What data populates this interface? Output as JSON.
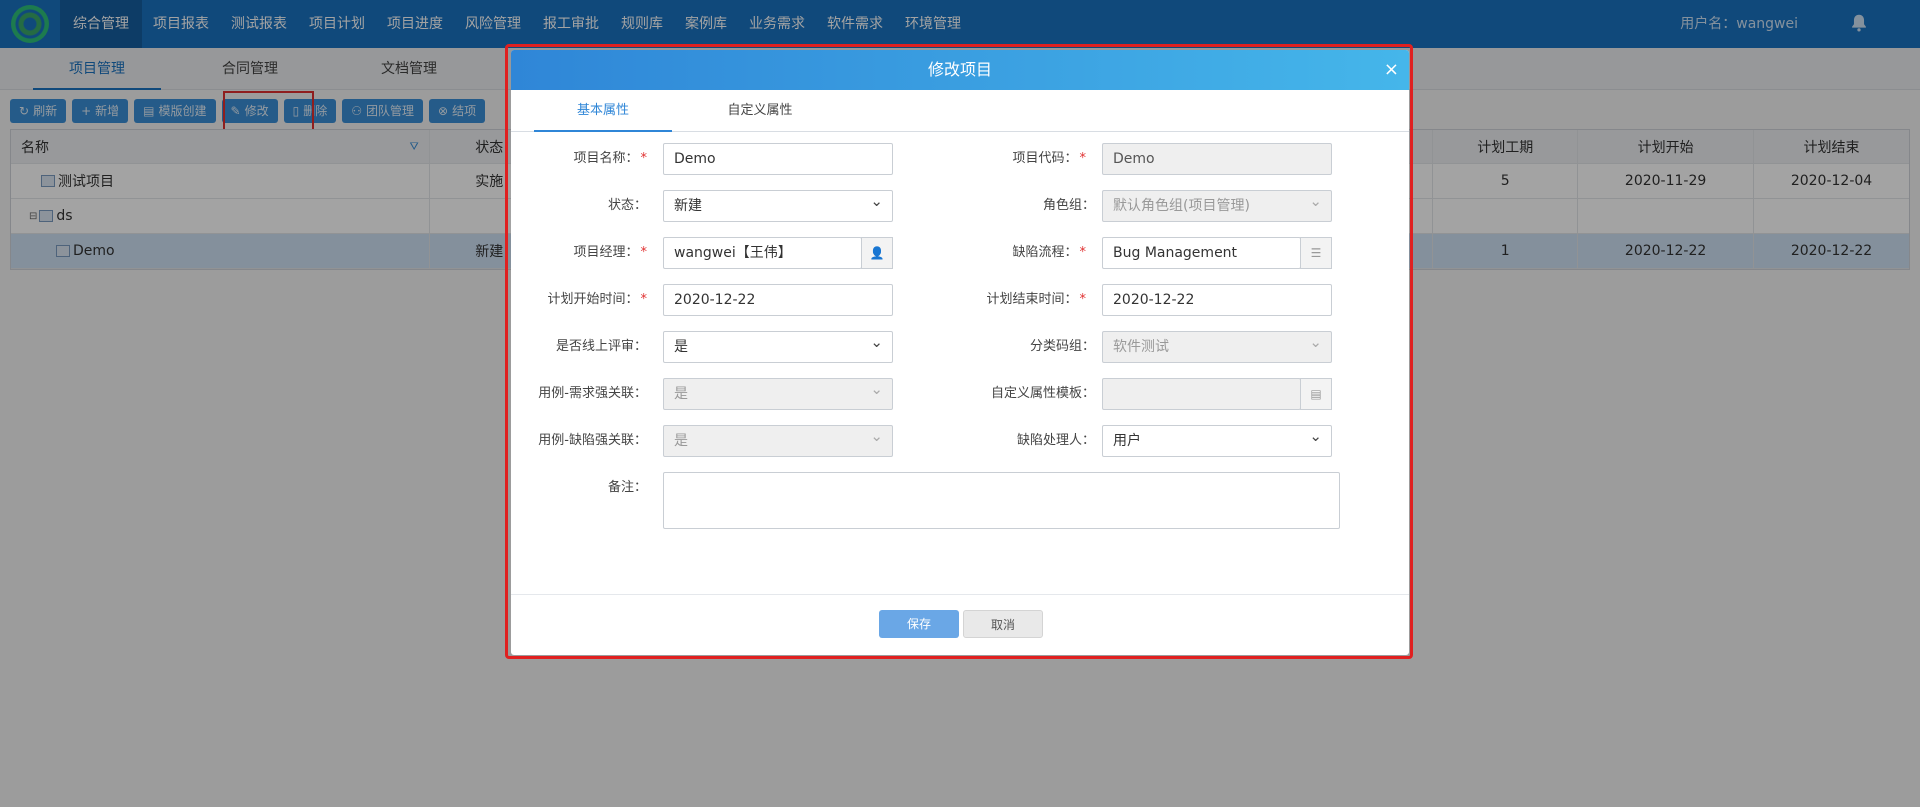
{
  "nav": {
    "items": [
      "综合管理",
      "项目报表",
      "测试报表",
      "项目计划",
      "项目进度",
      "风险管理",
      "报工审批",
      "规则库",
      "案例库",
      "业务需求",
      "软件需求",
      "环境管理"
    ],
    "active_index": 0,
    "user_label": "用户名：wangwei",
    "bell_icon": "bell-icon"
  },
  "subtabs": [
    "项目管理",
    "合同管理",
    "文档管理"
  ],
  "toolbar": [
    {
      "icon": "↻",
      "label": "刷新"
    },
    {
      "icon": "+",
      "label": "新增"
    },
    {
      "icon": "▤",
      "label": "模版创建"
    },
    {
      "icon": "✎",
      "label": "修改"
    },
    {
      "icon": "▯",
      "label": "删除"
    },
    {
      "icon": "⚇",
      "label": "团队管理"
    },
    {
      "icon": "⊗",
      "label": "结项"
    }
  ],
  "grid": {
    "headers": {
      "name": "名称",
      "status": "状态",
      "period": "计划工期",
      "start": "计划开始",
      "end": "计划结束"
    },
    "rows": [
      {
        "name": "测试项目",
        "status": "实施",
        "period": "5",
        "start": "2020-11-29",
        "end": "2020-12-04"
      },
      {
        "name": "ds",
        "status": "",
        "period": "",
        "start": "",
        "end": ""
      },
      {
        "name": "Demo",
        "status": "新建",
        "period": "1",
        "start": "2020-12-22",
        "end": "2020-12-22"
      }
    ]
  },
  "dialog": {
    "title": "修改项目",
    "close": "×",
    "tabs": [
      "基本属性",
      "自定义属性"
    ],
    "fields": {
      "project_name": {
        "label": "项目名称：",
        "value": "Demo"
      },
      "project_code": {
        "label": "项目代码：",
        "value": "Demo"
      },
      "status": {
        "label": "状态：",
        "value": "新建"
      },
      "role_group": {
        "label": "角色组：",
        "value": "默认角色组(项目管理)"
      },
      "manager": {
        "label": "项目经理：",
        "value": "wangwei【王伟】"
      },
      "defect_flow": {
        "label": "缺陷流程：",
        "value": "Bug Management"
      },
      "plan_start": {
        "label": "计划开始时间：",
        "value": "2020-12-22"
      },
      "plan_end": {
        "label": "计划结束时间：",
        "value": "2020-12-22"
      },
      "online_review": {
        "label": "是否线上评审：",
        "value": "是"
      },
      "category_group": {
        "label": "分类码组：",
        "value": "软件测试"
      },
      "case_req_link": {
        "label": "用例-需求强关联：",
        "value": "是"
      },
      "custom_template": {
        "label": "自定义属性模板：",
        "value": ""
      },
      "case_defect_link": {
        "label": "用例-缺陷强关联：",
        "value": "是"
      },
      "defect_handler": {
        "label": "缺陷处理人：",
        "value": "用户"
      },
      "remarks": {
        "label": "备注：",
        "value": ""
      }
    },
    "required_mark": "*",
    "save_label": "保存",
    "cancel_label": "取消"
  }
}
